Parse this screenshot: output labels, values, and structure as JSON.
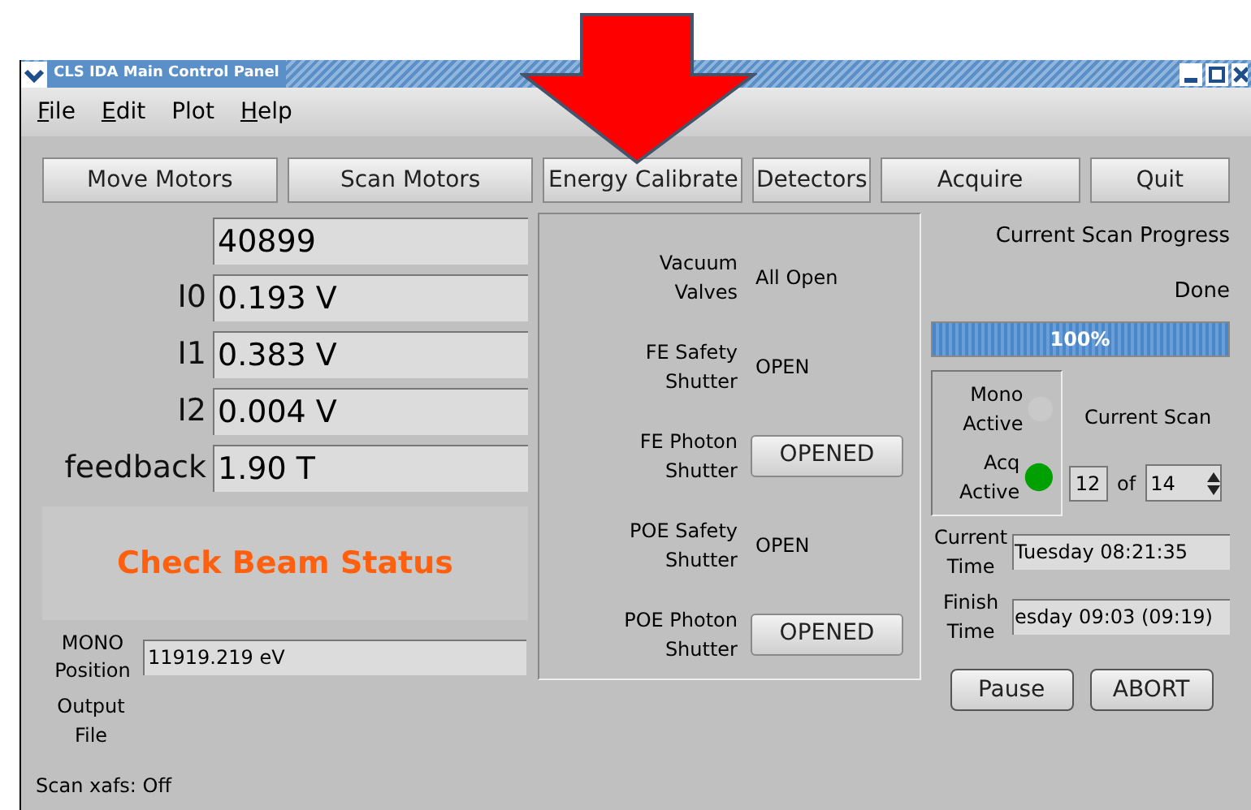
{
  "window": {
    "title": "CLS IDA Main Control Panel"
  },
  "menu": [
    {
      "label": "File",
      "underlined": true
    },
    {
      "label": "Edit",
      "underlined": true
    },
    {
      "label": "Plot",
      "underlined": false
    },
    {
      "label": "Help",
      "underlined": true
    }
  ],
  "toolbar": [
    "Move Motors",
    "Scan Motors",
    "Energy Calibrate",
    "Detectors",
    "Acquire",
    "Quit"
  ],
  "readings": [
    {
      "value": "40899"
    },
    {
      "label": "I0",
      "value": "0.193 V"
    },
    {
      "label": "I1",
      "value": "0.383 V"
    },
    {
      "label": "I2",
      "value": "0.004 V"
    },
    {
      "label": "feedback",
      "value": "1.90 T"
    }
  ],
  "beam_status": "Check Beam Status",
  "mono_position": {
    "label": "MONO Position",
    "value": "11919.219 eV"
  },
  "output_file": {
    "label": "Output File"
  },
  "shutters": [
    {
      "label": "Vacuum Valves",
      "kind": "text",
      "value": "All Open"
    },
    {
      "label": "FE Safety Shutter",
      "kind": "text",
      "value": "OPEN"
    },
    {
      "label": "FE Photon Shutter",
      "kind": "button",
      "value": "OPENED"
    },
    {
      "label": "POE Safety Shutter",
      "kind": "text",
      "value": "OPEN"
    },
    {
      "label": "POE Photon Shutter",
      "kind": "button",
      "value": "OPENED"
    }
  ],
  "progress": {
    "title": "Current Scan Progress",
    "status": "Done",
    "level": 1,
    "reading": "100%"
  },
  "indicators": [
    {
      "label": "Mono Active",
      "on": false
    },
    {
      "label": "Acq Active",
      "on": true
    }
  ],
  "current_scan": {
    "label": "Current Scan",
    "index": "12",
    "of": "of",
    "total": "14"
  },
  "current_time": {
    "label": "Current Time",
    "value": "Tuesday 08:21:35"
  },
  "finish_time": {
    "label": "Finish Time",
    "value": "esday 09:03  (09:19)"
  },
  "actions": [
    "Pause",
    "ABORT"
  ],
  "status_bar": "Scan xafs: Off"
}
